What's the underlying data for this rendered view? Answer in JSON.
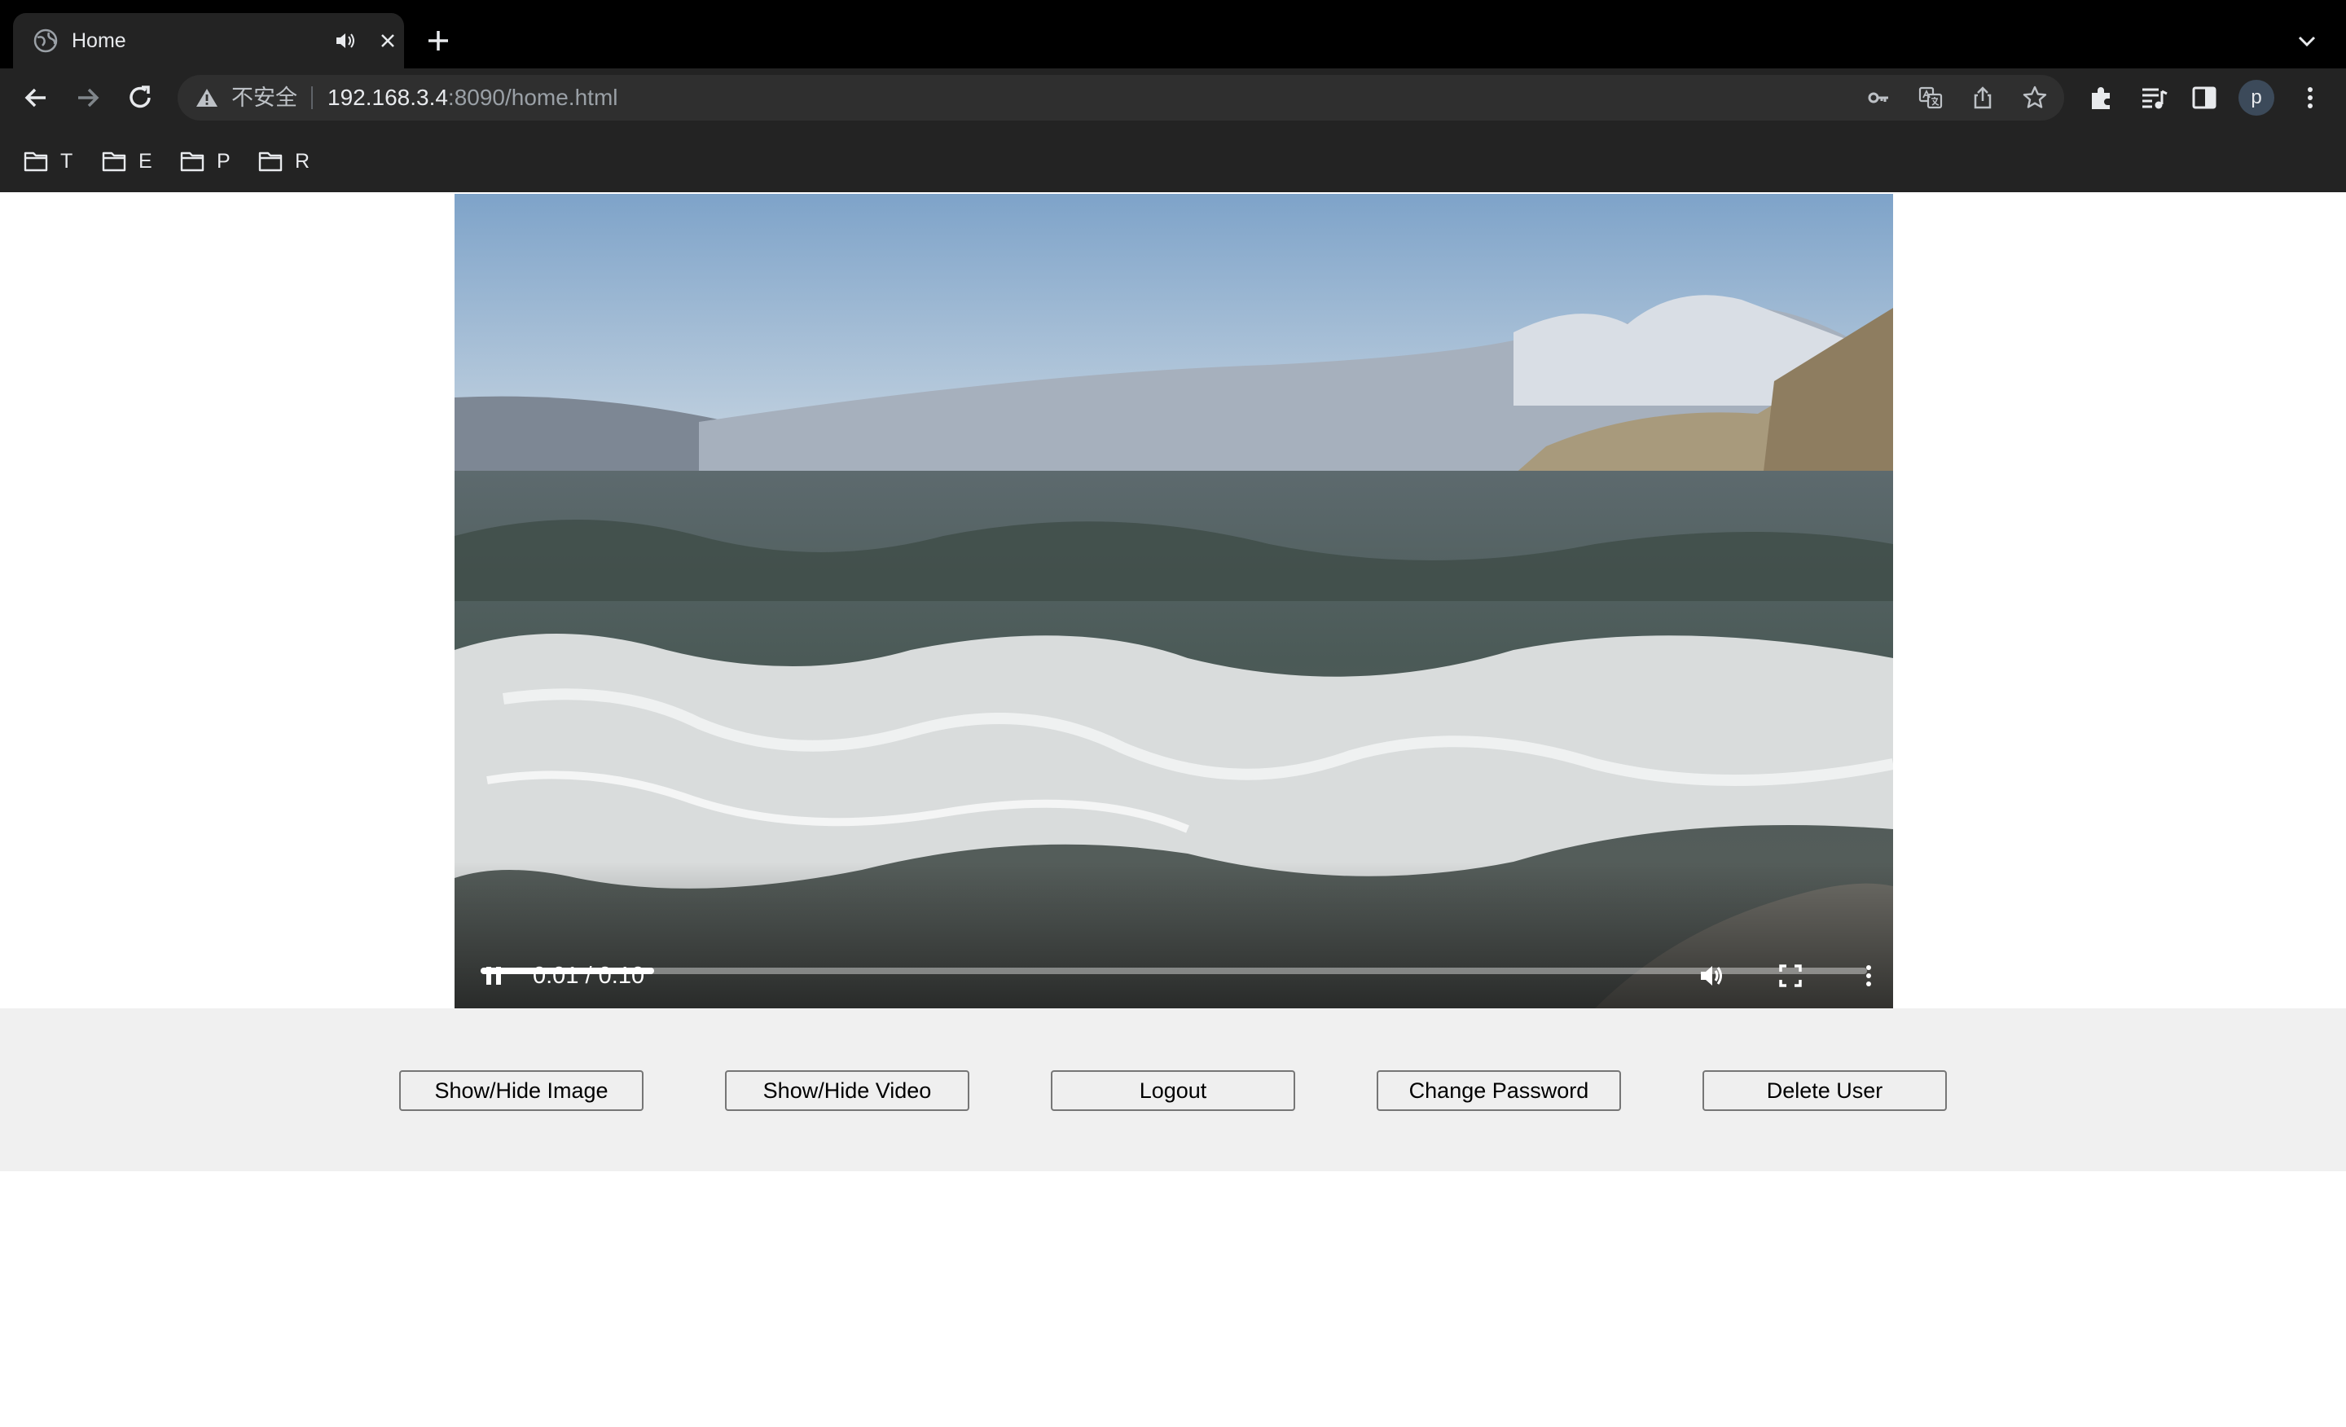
{
  "browser": {
    "tab": {
      "title": "Home"
    },
    "omnibox": {
      "security_label": "不安全",
      "url_host": "192.168.3.4",
      "url_rest": ":8090/home.html"
    },
    "profile_initial": "p",
    "bookmarks": [
      {
        "label": "T",
        "icon": "folder-icon"
      },
      {
        "label": "E",
        "icon": "folder-icon"
      },
      {
        "label": "P",
        "icon": "folder-icon"
      },
      {
        "label": "R",
        "icon": "folder-icon"
      }
    ],
    "colors": {
      "chrome_bg": "#000000",
      "toolbar_bg": "#232323",
      "omnibox_bg": "#2f2f2f"
    }
  },
  "video": {
    "state": "playing",
    "current_time": "0:01",
    "separator": "/",
    "duration": "0:10",
    "progress_fraction": 0.125,
    "icons": [
      "pause-icon",
      "volume-icon",
      "fullscreen-icon",
      "more-options-icon"
    ]
  },
  "actions": {
    "show_hide_image": "Show/Hide Image",
    "show_hide_video": "Show/Hide Video",
    "logout": "Logout",
    "change_password": "Change Password",
    "delete_user": "Delete User"
  }
}
